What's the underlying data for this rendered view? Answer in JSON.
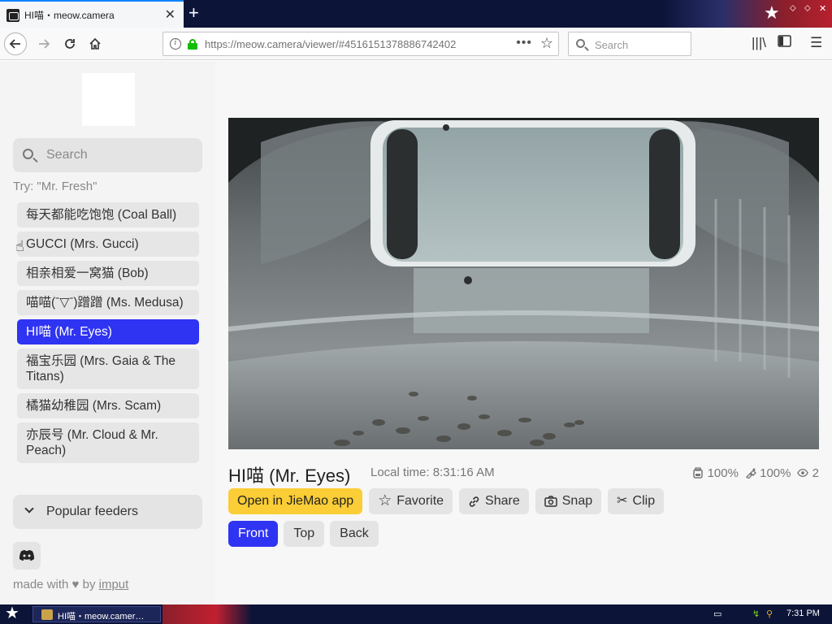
{
  "browser": {
    "tab_title": "HI喵・meow.camera",
    "url_host": "https://meow.camera",
    "url_path": "/viewer/#4516151378886742402",
    "search_placeholder": "Search",
    "page_actions_icon": "•••"
  },
  "sidebar": {
    "search_placeholder": "Search",
    "try_hint": "Try: \"Mr. Fresh\"",
    "cameras": [
      {
        "label": "每天都能吃饱饱 (Coal Ball)",
        "active": false
      },
      {
        "label": "GUCCI (Mrs. Gucci)",
        "active": false
      },
      {
        "label": "相亲相爱一窝猫 (Bob)",
        "active": false
      },
      {
        "label": "喵喵(ˉ▽ˉ)蹭蹭 (Ms. Medusa)",
        "active": false
      },
      {
        "label": "HI喵 (Mr. Eyes)",
        "active": true
      },
      {
        "label": "福宝乐园 (Mrs. Gaia & The Titans)",
        "active": false
      },
      {
        "label": "橘猫幼稚园 (Mrs. Scam)",
        "active": false
      },
      {
        "label": "亦辰号 (Mr. Cloud & Mr. Peach)",
        "active": false
      }
    ],
    "popular_feeders": "Popular feeders",
    "credit_prefix": "made with",
    "credit_by": "by",
    "credit_link": "imput"
  },
  "main": {
    "camera_title": "HI喵 (Mr. Eyes)",
    "local_time": "Local time: 8:31:16 AM",
    "food_level": "100%",
    "water_level": "100%",
    "viewers": "2",
    "actions": {
      "open_app": "Open in JieMao app",
      "favorite": "Favorite",
      "share": "Share",
      "snap": "Snap",
      "clip": "Clip"
    },
    "views": [
      {
        "label": "Front",
        "active": true
      },
      {
        "label": "Top",
        "active": false
      },
      {
        "label": "Back",
        "active": false
      }
    ]
  },
  "taskbar": {
    "task_label": "HI喵・meow.camer…",
    "clock": "7:31 PM"
  },
  "colors": {
    "accent": "#2f34f2",
    "primary_button": "#fbcd36",
    "taskbar": "#0c1438"
  }
}
